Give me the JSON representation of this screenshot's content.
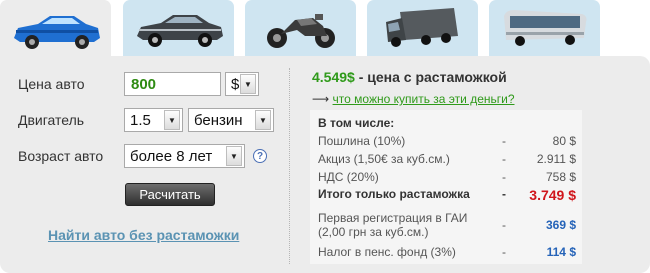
{
  "tabs": [
    {
      "name": "car-blue-icon",
      "active": true
    },
    {
      "name": "car-grey-icon",
      "active": false
    },
    {
      "name": "motorcycle-icon",
      "active": false
    },
    {
      "name": "truck-icon",
      "active": false
    },
    {
      "name": "bus-icon",
      "active": false
    }
  ],
  "form": {
    "price_label": "Цена авто",
    "price_value": "800",
    "currency": "$",
    "engine_label": "Двигатель",
    "engine_volume": "1.5",
    "fuel": "бензин",
    "age_label": "Возраст авто",
    "age_value": "более 8 лет",
    "help_symbol": "?",
    "calc_button": "Расчитать",
    "find_link": "Найти авто без растаможки"
  },
  "result": {
    "total_amount": "4.549$",
    "total_text": "- цена с растаможкой",
    "arrow": "⟶",
    "what_link": "что можно купить за эти деньги?",
    "including_label": "В том числе:",
    "rows": [
      {
        "name": "Пошлина (10%)",
        "dash": "-",
        "value": "80 $"
      },
      {
        "name": "Акциз (1,50€ за куб.см.)",
        "dash": "-",
        "value": "2.911 $"
      },
      {
        "name": "НДС (20%)",
        "dash": "-",
        "value": "758 $"
      }
    ],
    "customs_total_label": "Итого только растаможка",
    "customs_total_dash": "-",
    "customs_total_value": "3.749 $",
    "registration_label_1": "Первая регистрация в ГАИ",
    "registration_label_2": "(2,00 грн за куб.см.)",
    "registration_dash": "-",
    "registration_value": "369 $",
    "pension_label": "Налог в пенс. фонд (3%)",
    "pension_dash": "-",
    "pension_value": "114 $"
  },
  "colors": {
    "tab_inactive": "#cfe5f1",
    "panel": "#ececec",
    "green": "#2f9a1a",
    "red": "#d0151b",
    "blue": "#2563b8",
    "link": "#5b93b3"
  }
}
